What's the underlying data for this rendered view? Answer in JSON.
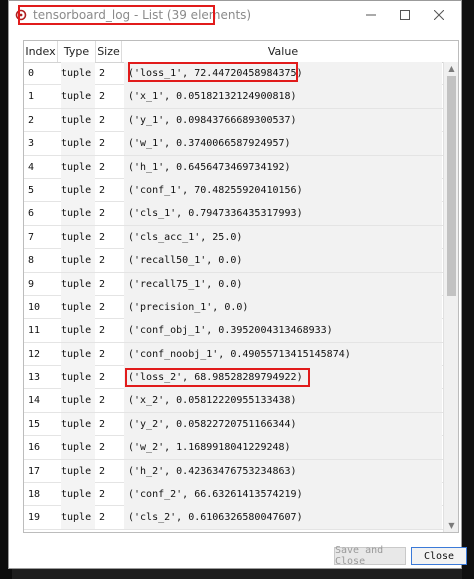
{
  "window": {
    "title": "tensorboard_log - List (39 elements)"
  },
  "table": {
    "headers": [
      "Index",
      "Type",
      "Size",
      "Value"
    ],
    "rows": [
      {
        "index": "0",
        "type": "tuple",
        "size": "2",
        "value": "('loss_1', 72.44720458984375)"
      },
      {
        "index": "1",
        "type": "tuple",
        "size": "2",
        "value": "('x_1', 0.05182132124900818)"
      },
      {
        "index": "2",
        "type": "tuple",
        "size": "2",
        "value": "('y_1', 0.09843766689300537)"
      },
      {
        "index": "3",
        "type": "tuple",
        "size": "2",
        "value": "('w_1', 0.3740066587924957)"
      },
      {
        "index": "4",
        "type": "tuple",
        "size": "2",
        "value": "('h_1', 0.6456473469734192)"
      },
      {
        "index": "5",
        "type": "tuple",
        "size": "2",
        "value": "('conf_1', 70.48255920410156)"
      },
      {
        "index": "6",
        "type": "tuple",
        "size": "2",
        "value": "('cls_1', 0.7947336435317993)"
      },
      {
        "index": "7",
        "type": "tuple",
        "size": "2",
        "value": "('cls_acc_1', 25.0)"
      },
      {
        "index": "8",
        "type": "tuple",
        "size": "2",
        "value": "('recall50_1', 0.0)"
      },
      {
        "index": "9",
        "type": "tuple",
        "size": "2",
        "value": "('recall75_1', 0.0)"
      },
      {
        "index": "10",
        "type": "tuple",
        "size": "2",
        "value": "('precision_1', 0.0)"
      },
      {
        "index": "11",
        "type": "tuple",
        "size": "2",
        "value": "('conf_obj_1', 0.3952004313468933)"
      },
      {
        "index": "12",
        "type": "tuple",
        "size": "2",
        "value": "('conf_noobj_1', 0.4905571341514587​4)"
      },
      {
        "index": "13",
        "type": "tuple",
        "size": "2",
        "value": "('loss_2', 68.98528289794922)"
      },
      {
        "index": "14",
        "type": "tuple",
        "size": "2",
        "value": "('x_2', 0.05812220955133438)"
      },
      {
        "index": "15",
        "type": "tuple",
        "size": "2",
        "value": "('y_2', 0.05822720751166344)"
      },
      {
        "index": "16",
        "type": "tuple",
        "size": "2",
        "value": "('w_2', 1.1689918041229248)"
      },
      {
        "index": "17",
        "type": "tuple",
        "size": "2",
        "value": "('h_2', 0.42363476753234863)"
      },
      {
        "index": "18",
        "type": "tuple",
        "size": "2",
        "value": "('conf_2', 66.63261413574219)"
      },
      {
        "index": "19",
        "type": "tuple",
        "size": "2",
        "value": "('cls_2', 0.6106326580047607)"
      }
    ]
  },
  "buttons": {
    "save_close": "Save and Close",
    "close": "Close"
  },
  "colors": {
    "highlight": "#e11b1b",
    "accent": "#3b7ad8"
  }
}
